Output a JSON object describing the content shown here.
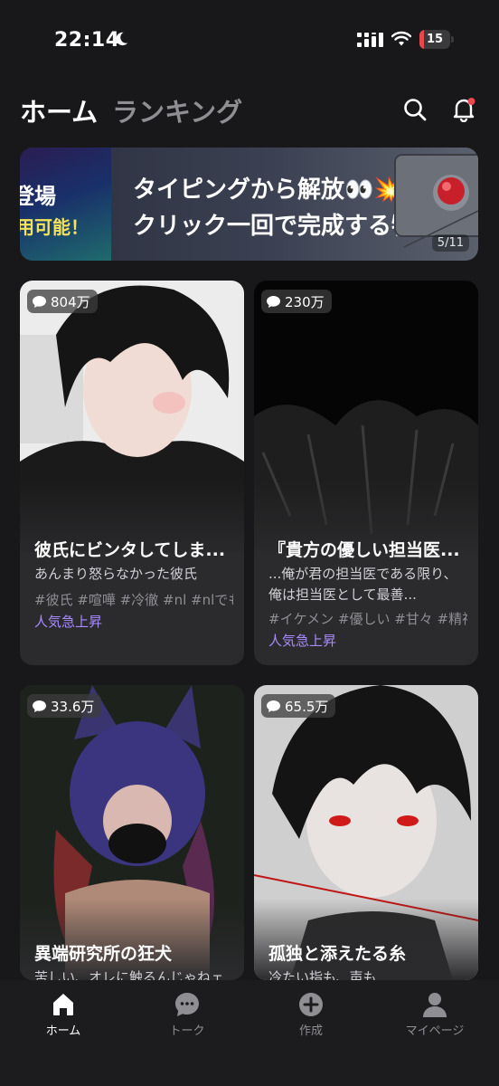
{
  "status_bar": {
    "time": "22:14",
    "battery": "15",
    "battery_level": 0.15
  },
  "header": {
    "tabs": [
      {
        "label": "ホーム",
        "active": true
      },
      {
        "label": "ランキング",
        "active": false
      }
    ]
  },
  "banner": {
    "left_text_1": "登場",
    "left_text_2": "用可能！",
    "line1": "タイピングから解放👀💥",
    "line2": "クリック一回で完成する物語",
    "page": "5/11"
  },
  "cards": [
    {
      "views": "804万",
      "title": "彼氏にビンタしてしま...",
      "desc": "あんまり怒らなかった彼氏",
      "tags": "#彼氏 #喧嘩 #冷徹 #nl #nlでも",
      "trend": "人気急上昇"
    },
    {
      "views": "230万",
      "title": "『貴方の優しい担当医...",
      "desc": "...俺が君の担当医である限り、俺は担当医として最善...",
      "tags": "#イケメン #優しい #甘々 #精神",
      "trend": "人気急上昇"
    },
    {
      "views": "33.6万",
      "title": "異端研究所の狂犬",
      "desc": "苦しい、オレに触るんじゃねェ"
    },
    {
      "views": "65.5万",
      "title": "孤独と添えたる糸",
      "desc": "冷たい指も、声も"
    }
  ],
  "bottom_nav": [
    {
      "label": "ホーム",
      "icon": "home-icon",
      "active": true
    },
    {
      "label": "トーク",
      "icon": "chat-icon",
      "active": false
    },
    {
      "label": "作成",
      "icon": "plus-circle-icon",
      "active": false
    },
    {
      "label": "マイページ",
      "icon": "user-icon",
      "active": false
    }
  ],
  "colors": {
    "background": "#18181b",
    "card": "#2b2b2e",
    "accent_trend": "#a98bff",
    "notification_dot": "#e5484d"
  }
}
